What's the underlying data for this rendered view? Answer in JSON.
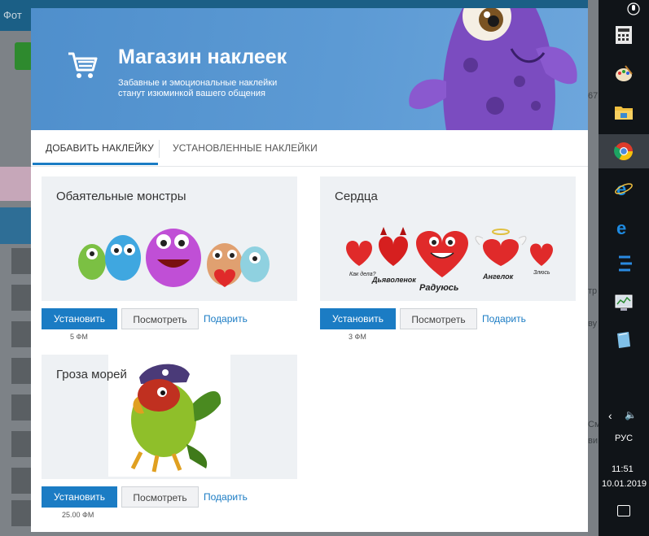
{
  "background_app": {
    "title_fragment": "Фот",
    "right_text_1": "67",
    "right_text_2": "тр",
    "right_text_3": "ву",
    "right_text_4": "См",
    "right_text_5": "ви"
  },
  "banner": {
    "title": "Магазин наклеек",
    "subtitle_line1": "Забавные и эмоциональные наклейки",
    "subtitle_line2": "станут изюминкой вашего общения",
    "cart_icon": "shopping-cart-icon"
  },
  "tabs": [
    {
      "label": "ДОБАВИТЬ НАКЛЕЙКУ",
      "active": true
    },
    {
      "label": "УСТАНОВЛЕННЫЕ НАКЛЕЙКИ",
      "active": false
    }
  ],
  "packs": [
    {
      "title": "Обаятельные монстры",
      "install_label": "Установить",
      "view_label": "Посмотреть",
      "gift_label": "Подарить",
      "price": "5 ФМ"
    },
    {
      "title": "Сердца",
      "install_label": "Установить",
      "view_label": "Посмотреть",
      "gift_label": "Подарить",
      "price": "3 ФМ",
      "sticker_captions": [
        "Как дела?",
        "Дьяволенок",
        "Радуюсь",
        "Ангелок",
        "Злюсь"
      ]
    },
    {
      "title": "Гроза морей",
      "install_label": "Установить",
      "view_label": "Посмотреть",
      "gift_label": "Подарить",
      "price": "25.00 ФМ"
    }
  ],
  "taskbar": {
    "language": "РУС",
    "time": "11:51",
    "date": "10.01.2019"
  },
  "colors": {
    "accent": "#1b7cc4",
    "banner": "#5c9ad4",
    "card_bg": "#eef1f4",
    "taskbar": "#101418"
  }
}
